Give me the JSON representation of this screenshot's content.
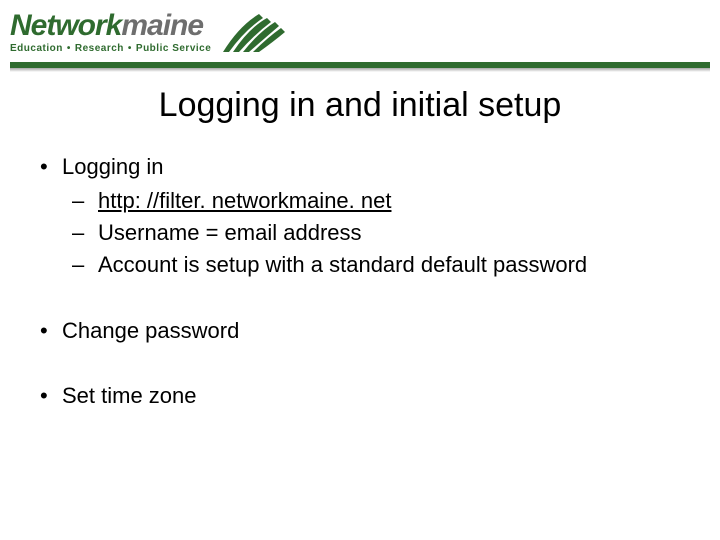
{
  "header": {
    "brand_part1": "Network",
    "brand_part2": "maine",
    "tagline_1": "Education",
    "tagline_2": "Research",
    "tagline_3": "Public Service"
  },
  "slide": {
    "title": "Logging in and initial setup",
    "bullets": [
      {
        "text": "Logging in",
        "sub": [
          {
            "text": "http: //filter. networkmaine. net",
            "link": true
          },
          {
            "text": "Username = email address",
            "link": false
          },
          {
            "text": "Account is setup with a standard default password",
            "link": false
          }
        ]
      },
      {
        "text": "Change password",
        "sub": []
      },
      {
        "text": "Set time zone",
        "sub": []
      }
    ]
  }
}
